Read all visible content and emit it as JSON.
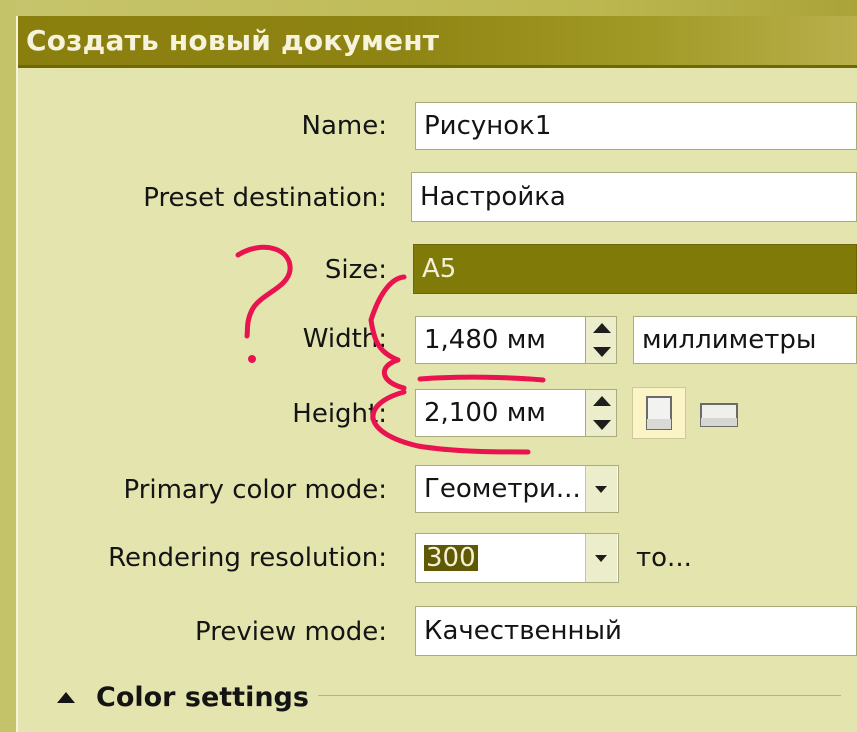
{
  "dialog": {
    "title": "Создать новый документ"
  },
  "form": {
    "name": {
      "label": "Name:",
      "value": "Рисунок1"
    },
    "preset": {
      "label": "Preset destination:",
      "value": "Настройка"
    },
    "size": {
      "label": "Size:",
      "value": "A5"
    },
    "width": {
      "label": "Width:",
      "value": "1,480 мм",
      "unit": "миллиметры"
    },
    "height": {
      "label": "Height:",
      "value": "2,100 мм"
    },
    "color_mode": {
      "label": "Primary color mode:",
      "value": "Геометри..."
    },
    "resolution": {
      "label": "Rendering resolution:",
      "value": "300",
      "unit": "то..."
    },
    "preview": {
      "label": "Preview mode:",
      "value": "Качественный"
    }
  },
  "sections": {
    "color_settings": "Color settings"
  },
  "annotations": {
    "question_mark": "?"
  },
  "colors": {
    "title_bar": "#8a7f0e",
    "panel_background": "#e4e5ae",
    "selection": "#807a09",
    "annotation_ink": "#e8134f"
  },
  "icons": {
    "spin_up": "triangle-up-icon",
    "spin_down": "triangle-down-icon",
    "dropdown": "chevron-down-icon",
    "portrait": "portrait-page-icon",
    "landscape": "landscape-page-icon",
    "collapse": "triangle-up-icon"
  }
}
